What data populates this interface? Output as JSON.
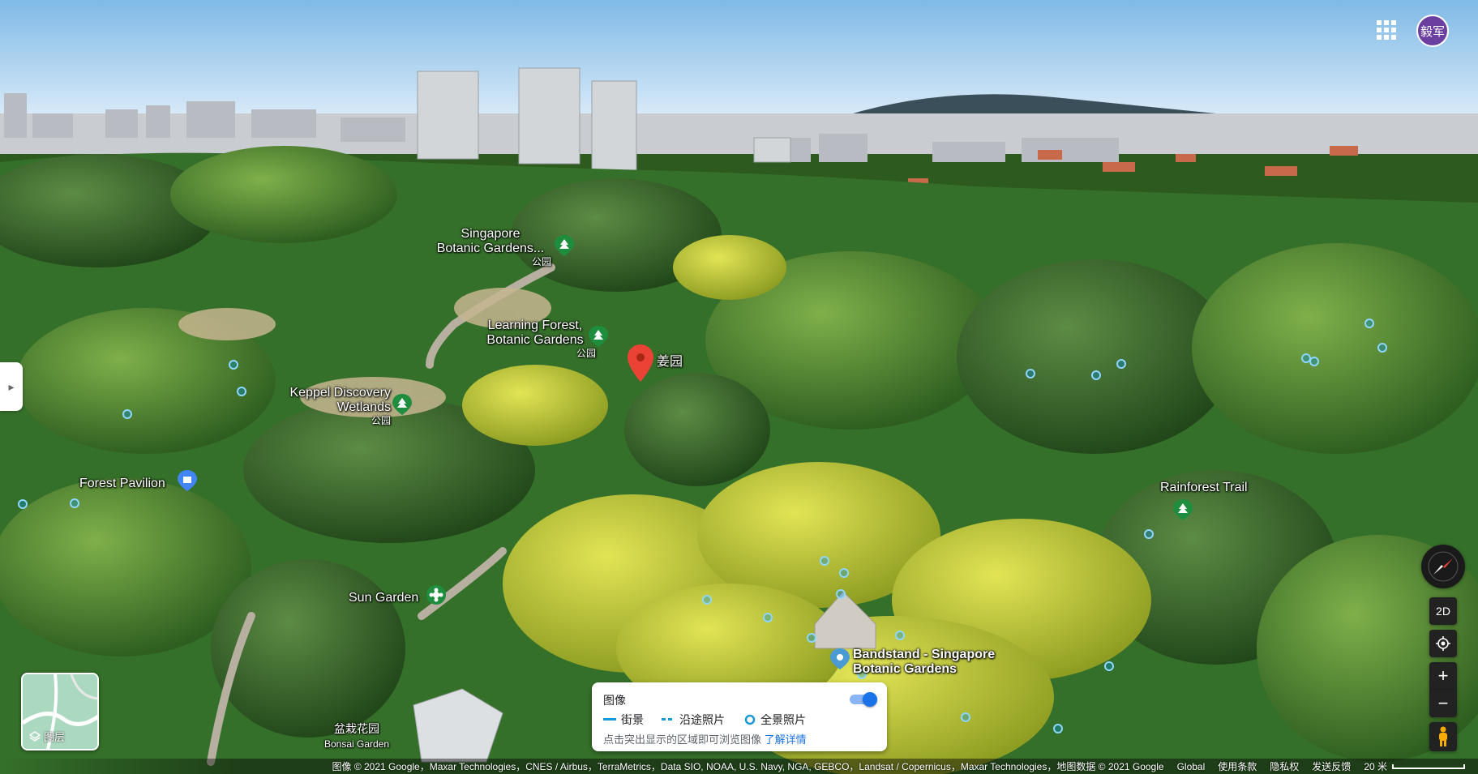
{
  "account": {
    "avatar_text": "毅军"
  },
  "map_labels": {
    "singapore_botanic": {
      "line1": "Singapore",
      "line2": "Botanic Gardens...",
      "sub": "公园"
    },
    "learning_forest": {
      "line1": "Learning Forest,",
      "line2": "Botanic Gardens",
      "sub": "公园"
    },
    "ginger_garden": {
      "name": "姜园"
    },
    "keppel": {
      "line1": "Keppel Discovery",
      "line2": "Wetlands",
      "sub": "公园"
    },
    "forest_pavilion": {
      "name": "Forest Pavilion"
    },
    "rainforest_trail": {
      "name": "Rainforest Trail"
    },
    "sun_garden": {
      "name": "Sun Garden"
    },
    "bandstand": {
      "line1": "Bandstand - Singapore",
      "line2": "Botanic Gardens"
    },
    "bonsai": {
      "line1": "盆栽花园",
      "line2": "Bonsai Garden"
    }
  },
  "layers": {
    "label": "图层"
  },
  "controls": {
    "two_d": "2D",
    "zoom_in": "+",
    "zoom_out": "−"
  },
  "imagery": {
    "title": "图像",
    "legend_street": "街景",
    "legend_route": "沿途照片",
    "legend_panorama": "全景照片",
    "hint": "点击突出显示的区域即可浏览图像",
    "learn_more": "了解详情",
    "toggle_on": true
  },
  "attribution": {
    "credits": "图像 © 2021 Google，Maxar Technologies，CNES / Airbus，TerraMetrics，Data SIO, NOAA, U.S. Navy, NGA, GEBCO，Landsat / Copernicus，Maxar Technologies，地图数据 © 2021 Google",
    "global": "Global",
    "terms": "使用条款",
    "privacy": "隐私权",
    "feedback": "发送反馈",
    "scale": "20 米"
  },
  "colors": {
    "sky_top": "#8ec3ea",
    "sky_horizon": "#dfeefa",
    "forest_dark": "#2a5a1e",
    "forest_mid": "#4a8a2e",
    "flowers_yellow": "#d4d633",
    "pin_red": "#ea4335",
    "park_green": "#1e8e3e",
    "avatar": "#6b3fa0",
    "toggle_blue": "#1a73e8"
  }
}
